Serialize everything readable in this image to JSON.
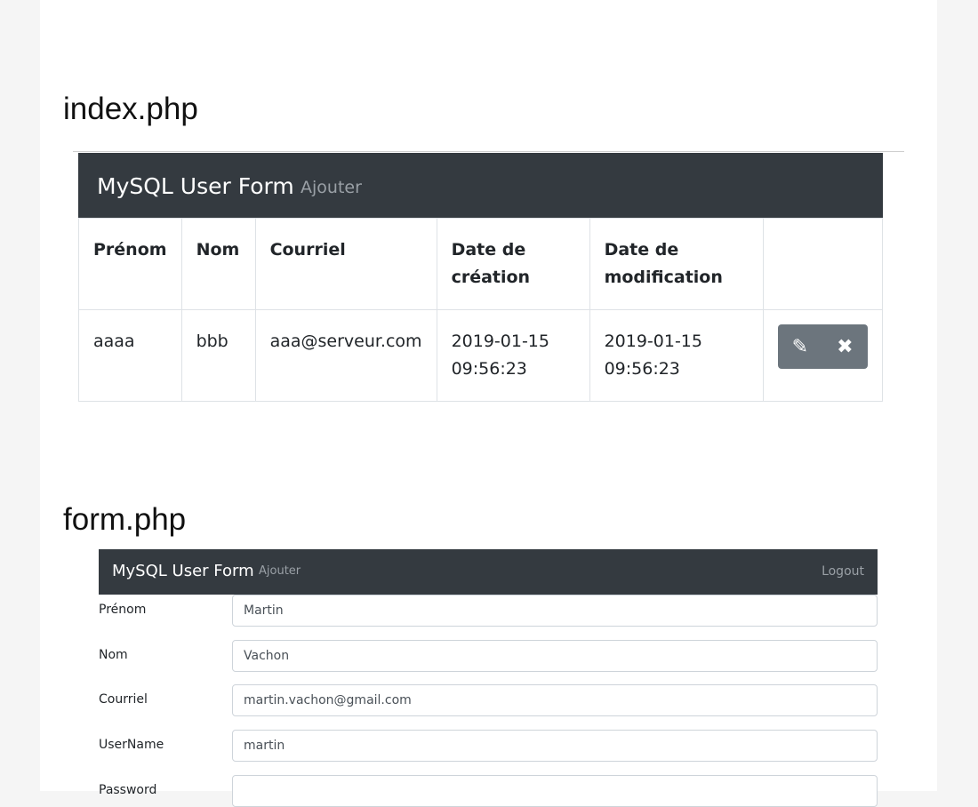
{
  "index_section": {
    "heading": "index.php",
    "navbar": {
      "brand": "MySQL User Form",
      "add_link": "Ajouter"
    },
    "table": {
      "headers": [
        "Prénom",
        "Nom",
        "Courriel",
        "Date de création",
        "Date de modification",
        ""
      ],
      "rows": [
        {
          "prenom": "aaaa",
          "nom": "bbb",
          "courriel": "aaa@serveur.com",
          "date_creation": "2019-01-15 09:56:23",
          "date_modification": "2019-01-15 09:56:23"
        }
      ],
      "actions": {
        "edit_icon": "pencil-icon",
        "delete_icon": "close-icon"
      }
    }
  },
  "form_section": {
    "heading": "form.php",
    "navbar": {
      "brand": "MySQL User Form",
      "add_link": "Ajouter",
      "logout_link": "Logout"
    },
    "fields": [
      {
        "label": "Prénom",
        "value": "Martin"
      },
      {
        "label": "Nom",
        "value": "Vachon"
      },
      {
        "label": "Courriel",
        "value": "martin.vachon@gmail.com"
      },
      {
        "label": "UserName",
        "value": "martin"
      },
      {
        "label": "Password",
        "value": ""
      }
    ]
  },
  "colors": {
    "navbar": "#343a40",
    "button_group": "#6c757d",
    "muted_link": "#9aa0a6"
  }
}
